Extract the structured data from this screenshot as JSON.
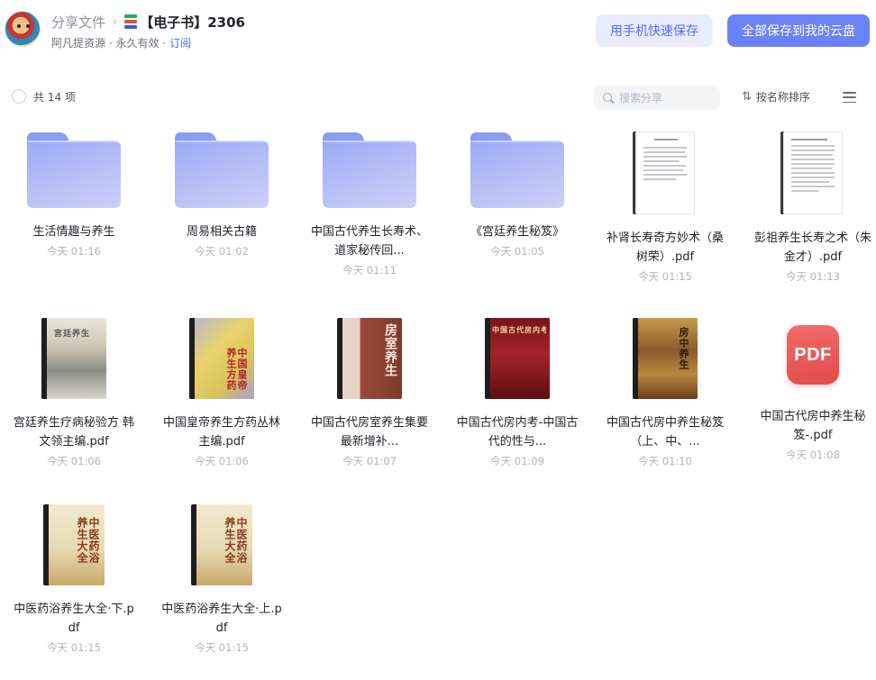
{
  "header": {
    "breadcrumb_parent": "分享文件",
    "breadcrumb_separator": "›",
    "folder_title": "【电子书】2306",
    "owner": "阿凡提资源",
    "validity": "永久有效",
    "dot1": "·",
    "dot2": "·",
    "subscribe_label": "订阅",
    "phone_save_label": "用手机快速保存",
    "save_all_label": "全部保存到我的云盘"
  },
  "toolbar": {
    "count_label": "共 14 项",
    "search_placeholder": "搜索分享",
    "sort_icon": "⇅",
    "sort_label": "按名称排序"
  },
  "colors": {
    "accent": "#4e6ef2",
    "primary_button": "#6b82f7",
    "secondary_button_bg": "#e9ecfd",
    "folder": "#9aaaf8",
    "pdf": "#e24b4b"
  },
  "items": [
    {
      "name": "生活情趣与养生",
      "time": "今天 01:16",
      "icon": "folder-icon"
    },
    {
      "name": "周易相关古籍",
      "time": "今天 01:02",
      "icon": "folder-icon"
    },
    {
      "name": "中国古代养生长寿术、道家秘传回...",
      "time": "今天 01:11",
      "icon": "folder-icon"
    },
    {
      "name": "《宫廷养生秘笈》",
      "time": "今天 01:05",
      "icon": "folder-icon"
    },
    {
      "name": "补肾长寿奇方妙术（桑树荣）.pdf",
      "time": "今天 01:15",
      "icon": "document-thumbnail"
    },
    {
      "name": "彭祖养生长寿之术（朱金才）.pdf",
      "time": "今天 01:13",
      "icon": "document-thumbnail"
    },
    {
      "name": "宫廷养生疗病秘验方 韩文领主编.pdf",
      "time": "今天 01:06",
      "icon": "book-cover-thumbnail",
      "cover_text": "宫廷养生"
    },
    {
      "name": "中国皇帝养生方药丛林主编.pdf",
      "time": "今天 01:06",
      "icon": "book-cover-thumbnail",
      "cover_text": "中国皇帝养生方药"
    },
    {
      "name": "中国古代房室养生集要 最新增补...",
      "time": "今天 01:07",
      "icon": "book-cover-thumbnail",
      "cover_text": "房室养生"
    },
    {
      "name": "中国古代房内考-中国古代的性与...",
      "time": "今天 01:09",
      "icon": "book-cover-thumbnail",
      "cover_text": "中国古代房内考"
    },
    {
      "name": "中国古代房中养生秘笈（上、中、...",
      "time": "今天 01:10",
      "icon": "book-cover-thumbnail",
      "cover_text": "房中养生"
    },
    {
      "name": "中国古代房中养生秘笈-.pdf",
      "time": "今天 01:08",
      "icon": "pdf-icon",
      "badge": "PDF"
    },
    {
      "name": "中医药浴养生大全·下.pdf",
      "time": "今天 01:15",
      "icon": "book-cover-thumbnail",
      "cover_text": "中医药浴养生大全"
    },
    {
      "name": "中医药浴养生大全·上.pdf",
      "time": "今天 01:15",
      "icon": "book-cover-thumbnail",
      "cover_text": "中医药浴养生大全"
    }
  ]
}
